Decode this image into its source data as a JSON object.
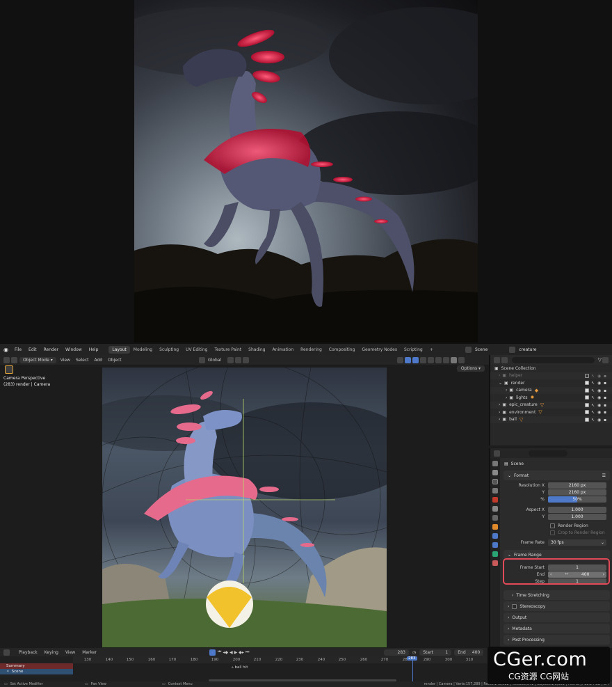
{
  "topbar": {
    "menus": [
      "File",
      "Edit",
      "Render",
      "Window",
      "Help"
    ],
    "workspaces": [
      "Layout",
      "Modeling",
      "Sculpting",
      "UV Editing",
      "Texture Paint",
      "Shading",
      "Animation",
      "Rendering",
      "Compositing",
      "Geometry Nodes",
      "Scripting",
      "+"
    ],
    "active_workspace": "Layout",
    "scene_name": "Scene",
    "view_layer": "creature"
  },
  "viewport_header": {
    "mode": "Object Mode",
    "menus": [
      "View",
      "Select",
      "Add",
      "Object"
    ],
    "transform_orientation": "Global",
    "options": "Options"
  },
  "viewport": {
    "perspective": "Camera Perspective",
    "frame_info": "(283) render | Camera"
  },
  "outliner": {
    "items": [
      {
        "label": "Scene Collection",
        "indent": 0
      },
      {
        "label": "helper",
        "indent": 1,
        "dim": true
      },
      {
        "label": "render",
        "indent": 1
      },
      {
        "label": "camera",
        "indent": 2
      },
      {
        "label": "lights",
        "indent": 2
      },
      {
        "label": "epic_creature",
        "indent": 1
      },
      {
        "label": "environment",
        "indent": 1
      },
      {
        "label": "ball",
        "indent": 1
      }
    ]
  },
  "properties": {
    "scene_label": "Scene",
    "format_panel": "Format",
    "resolution_x_label": "Resolution X",
    "resolution_x": "2160 px",
    "y_label": "Y",
    "resolution_y": "2160 px",
    "pct_label": "%",
    "resolution_pct": "50%",
    "resolution_pct_value": 0.5,
    "aspect_x_label": "Aspect X",
    "aspect_x": "1.000",
    "aspect_y": "1.000",
    "render_region": "Render Region",
    "crop_region": "Crop to Render Region",
    "frame_rate_label": "Frame Rate",
    "frame_rate": "30 fps",
    "frame_range_panel": "Frame Range",
    "frame_start_label": "Frame Start",
    "frame_start": "1",
    "end_label": "End",
    "frame_end": "400",
    "step_label": "Step",
    "frame_step": "1",
    "subpanels": [
      "Time Stretching",
      "Stereoscopy",
      "Output",
      "Metadata",
      "Post Processing"
    ]
  },
  "timeline": {
    "menus": [
      "Playback",
      "Keying",
      "View",
      "Marker"
    ],
    "current_frame": "283",
    "start_label": "Start",
    "start": "1",
    "end_label": "End",
    "end": "400",
    "ruler_ticks": [
      "130",
      "140",
      "150",
      "160",
      "170",
      "180",
      "190",
      "200",
      "210",
      "220",
      "230",
      "240",
      "250",
      "260",
      "270",
      "280",
      "290",
      "300",
      "310"
    ],
    "playhead": "283",
    "marker": "ball hit",
    "tracks": [
      "Summary",
      "Scene"
    ]
  },
  "statusbar": {
    "left1": "Set Active Modifier",
    "left2": "Pan View",
    "left3": "Context Menu",
    "right": "render | Camera | Verts:157,289 | Faces:140,512 | Tris:280,571 | Objects:1/1,083 | Memory: 11.14 GB | 3.4"
  },
  "watermark": {
    "title": "CGer.com",
    "subtitle": "CG资源 CG网站"
  },
  "colors": {
    "accent_blue": "#4d79c8",
    "highlight_red": "#e24a5a",
    "active_tool_orange": "#e3a43a"
  }
}
